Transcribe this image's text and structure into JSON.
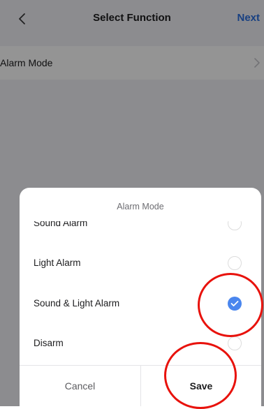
{
  "nav": {
    "back_icon": "chevron-left-icon",
    "title": "Select Function",
    "next_label": "Next"
  },
  "settings": {
    "row_label": "Alarm Mode",
    "row_icon": "chevron-right-icon"
  },
  "sheet": {
    "title": "Alarm Mode",
    "options": [
      {
        "label": "Sound Alarm",
        "selected": false
      },
      {
        "label": "Light Alarm",
        "selected": false
      },
      {
        "label": "Sound & Light Alarm",
        "selected": true
      },
      {
        "label": "Disarm",
        "selected": false
      }
    ],
    "cancel_label": "Cancel",
    "save_label": "Save"
  },
  "colors": {
    "accent": "#2a6fe0",
    "radio_checked": "#4a86ee",
    "annotation": "#e8120c"
  }
}
